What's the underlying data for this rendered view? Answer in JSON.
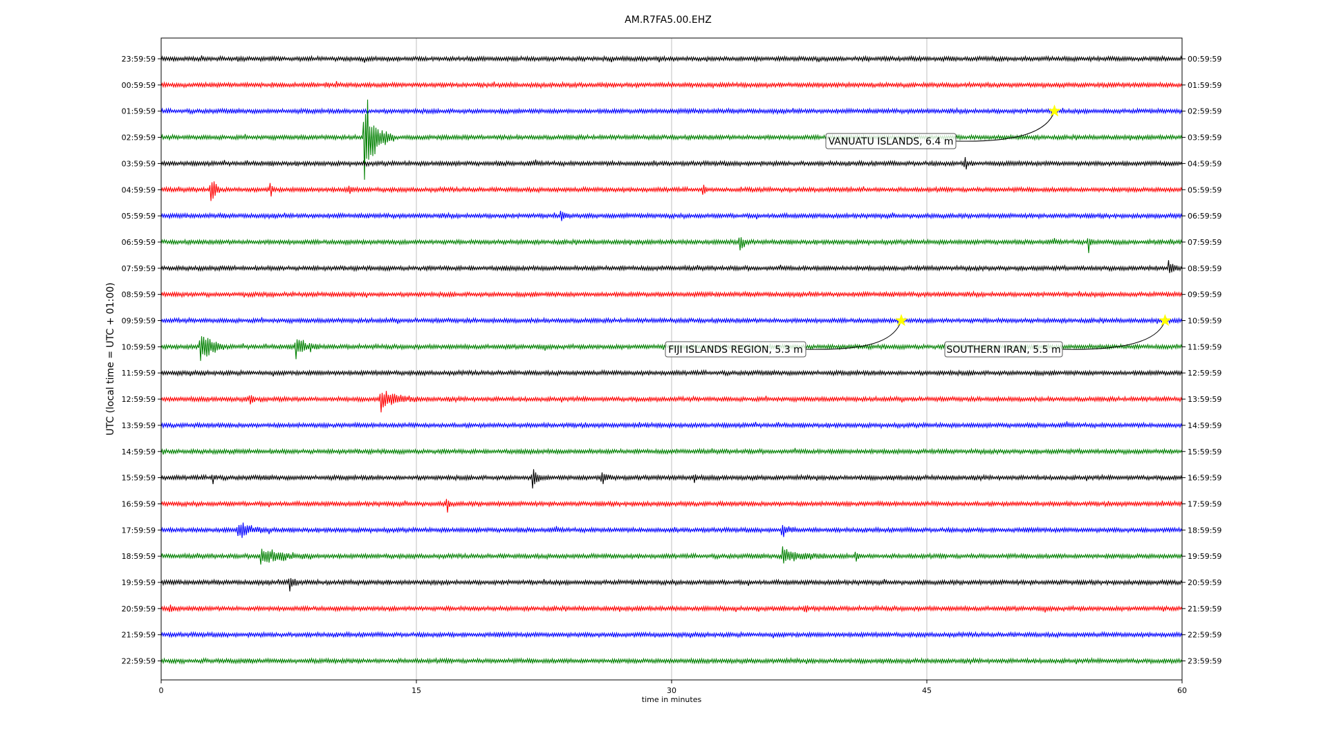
{
  "chart_data": {
    "type": "line",
    "title": "AM.R7FA5.00.EHZ",
    "xlabel": "time in minutes",
    "ylabel": "UTC (local time = UTC + 01:00)",
    "xlim": [
      0,
      60
    ],
    "x_ticks": [
      0,
      15,
      30,
      45,
      60
    ],
    "x_tick_labels": [
      "0",
      "15",
      "30",
      "45",
      "60"
    ],
    "grid": "vertical lines at x ticks",
    "trace_colors": [
      "#000000",
      "#ff0000",
      "#0000ff",
      "#008000"
    ],
    "left_labels": [
      "23:59:59",
      "00:59:59",
      "01:59:59",
      "02:59:59",
      "03:59:59",
      "04:59:59",
      "05:59:59",
      "06:59:59",
      "07:59:59",
      "08:59:59",
      "09:59:59",
      "10:59:59",
      "11:59:59",
      "12:59:59",
      "13:59:59",
      "14:59:59",
      "15:59:59",
      "16:59:59",
      "17:59:59",
      "18:59:59",
      "19:59:59",
      "20:59:59",
      "21:59:59",
      "22:59:59"
    ],
    "right_labels": [
      "00:59:59",
      "01:59:59",
      "02:59:59",
      "03:59:59",
      "04:59:59",
      "05:59:59",
      "06:59:59",
      "07:59:59",
      "08:59:59",
      "09:59:59",
      "10:59:59",
      "11:59:59",
      "12:59:59",
      "13:59:59",
      "14:59:59",
      "15:59:59",
      "16:59:59",
      "17:59:59",
      "18:59:59",
      "19:59:59",
      "20:59:59",
      "21:59:59",
      "22:59:59",
      "23:59:59"
    ],
    "events": [
      {
        "label": "VANUATU ISLANDS, 6.4 m",
        "row": 2,
        "x": 52.5
      },
      {
        "label": "FIJI ISLANDS REGION, 5.3 m",
        "row": 10,
        "x": 43.5
      },
      {
        "label": "SOUTHERN IRAN, 5.5 m",
        "row": 10,
        "x": 59.0
      }
    ],
    "marker_color": "#ffff00",
    "bursts": [
      {
        "row": 3,
        "x": 11.9,
        "amp": 2.3,
        "dur": 1.8
      },
      {
        "row": 4,
        "x": 47.2,
        "amp": 0.5,
        "dur": 0.4
      },
      {
        "row": 5,
        "x": 2.9,
        "amp": 0.9,
        "dur": 0.6
      },
      {
        "row": 5,
        "x": 6.4,
        "amp": 0.45,
        "dur": 0.3
      },
      {
        "row": 5,
        "x": 11.0,
        "amp": 0.45,
        "dur": 0.3
      },
      {
        "row": 5,
        "x": 31.8,
        "amp": 0.35,
        "dur": 0.3
      },
      {
        "row": 6,
        "x": 23.5,
        "amp": 0.45,
        "dur": 0.4
      },
      {
        "row": 7,
        "x": 34.0,
        "amp": 0.5,
        "dur": 0.6
      },
      {
        "row": 7,
        "x": 54.5,
        "amp": 0.4,
        "dur": 0.3
      },
      {
        "row": 8,
        "x": 59.2,
        "amp": 0.45,
        "dur": 0.6
      },
      {
        "row": 11,
        "x": 2.3,
        "amp": 1.0,
        "dur": 1.4
      },
      {
        "row": 11,
        "x": 7.9,
        "amp": 0.6,
        "dur": 1.4
      },
      {
        "row": 13,
        "x": 5.2,
        "amp": 0.45,
        "dur": 0.4
      },
      {
        "row": 13,
        "x": 12.9,
        "amp": 0.55,
        "dur": 2.2
      },
      {
        "row": 16,
        "x": 3.0,
        "amp": 0.4,
        "dur": 0.3
      },
      {
        "row": 16,
        "x": 21.8,
        "amp": 0.6,
        "dur": 0.6
      },
      {
        "row": 16,
        "x": 25.9,
        "amp": 0.45,
        "dur": 0.6
      },
      {
        "row": 16,
        "x": 31.3,
        "amp": 0.4,
        "dur": 0.2
      },
      {
        "row": 17,
        "x": 16.8,
        "amp": 0.45,
        "dur": 0.3
      },
      {
        "row": 18,
        "x": 4.5,
        "amp": 0.4,
        "dur": 2.0
      },
      {
        "row": 18,
        "x": 36.5,
        "amp": 0.4,
        "dur": 0.8
      },
      {
        "row": 19,
        "x": 5.8,
        "amp": 0.5,
        "dur": 3.0
      },
      {
        "row": 19,
        "x": 36.5,
        "amp": 0.45,
        "dur": 2.5
      },
      {
        "row": 19,
        "x": 40.8,
        "amp": 0.35,
        "dur": 0.3
      },
      {
        "row": 20,
        "x": 7.5,
        "amp": 0.4,
        "dur": 0.8
      },
      {
        "row": 21,
        "x": 0.5,
        "amp": 0.35,
        "dur": 0.3
      },
      {
        "row": 21,
        "x": 37.8,
        "amp": 0.3,
        "dur": 0.3
      }
    ]
  }
}
